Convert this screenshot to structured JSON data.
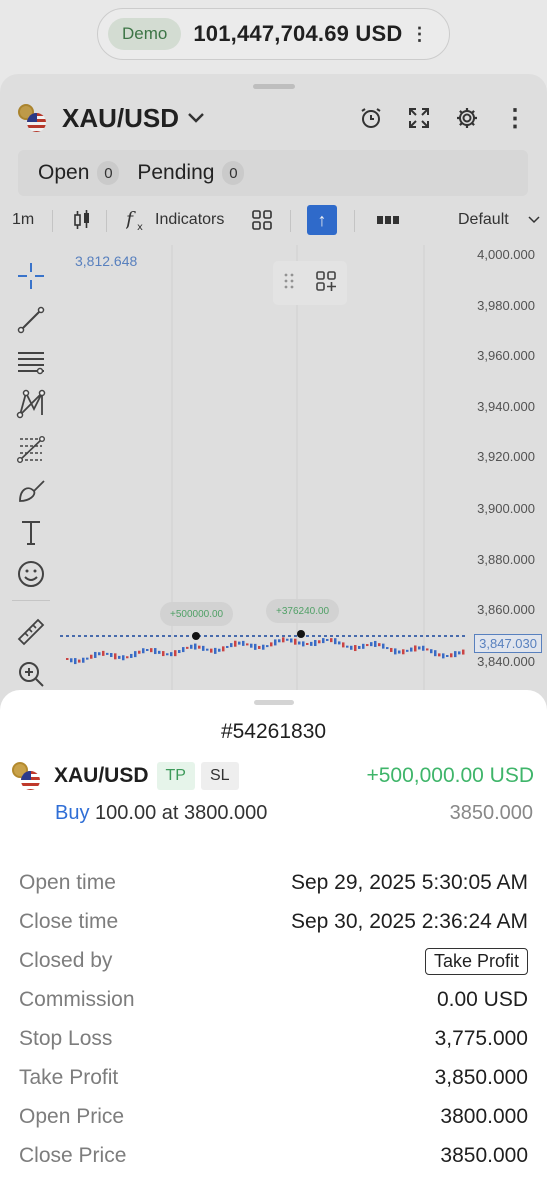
{
  "header": {
    "account_type": "Demo",
    "balance": "101,447,704.69 USD"
  },
  "instrument": {
    "symbol": "XAU/USD"
  },
  "tabs": [
    {
      "label": "Open",
      "count": "0"
    },
    {
      "label": "Pending",
      "count": "0"
    }
  ],
  "chart_toolbar": {
    "timeframe": "1m",
    "indicators_label": "Indicators",
    "layout_label": "Default"
  },
  "chart": {
    "top_left_price": "3,812.648",
    "price_levels": [
      "4,000.000",
      "3,980.000",
      "3,960.000",
      "3,940.000",
      "3,920.000",
      "3,900.000",
      "3,880.000",
      "3,860.000",
      "3,840.000"
    ],
    "last_price": "3,847.030",
    "bubbles": [
      "+500000.00",
      "+376240.00"
    ]
  },
  "order": {
    "id": "#54261830",
    "symbol": "XAU/USD",
    "tp_badge": "TP",
    "sl_badge": "SL",
    "profit": "+500,000.00 USD",
    "side": "Buy",
    "volume_text": "100.00 at 3800.000",
    "current_price": "3850.000",
    "details": [
      {
        "label": "Open time",
        "value": "Sep 29, 2025 5:30:05 AM"
      },
      {
        "label": "Close time",
        "value": "Sep 30, 2025 2:36:24 AM"
      },
      {
        "label": "Closed by",
        "value": "Take Profit"
      },
      {
        "label": "Commission",
        "value": "0.00 USD"
      },
      {
        "label": "Stop Loss",
        "value": "3,775.000"
      },
      {
        "label": "Take Profit",
        "value": "3,850.000"
      },
      {
        "label": "Open Price",
        "value": "3800.000"
      },
      {
        "label": "Close Price",
        "value": "3850.000"
      }
    ]
  },
  "colors": {
    "profit_green": "#3fb56a",
    "buy_blue": "#2f6ed6",
    "demo_green": "#3e7a48"
  }
}
